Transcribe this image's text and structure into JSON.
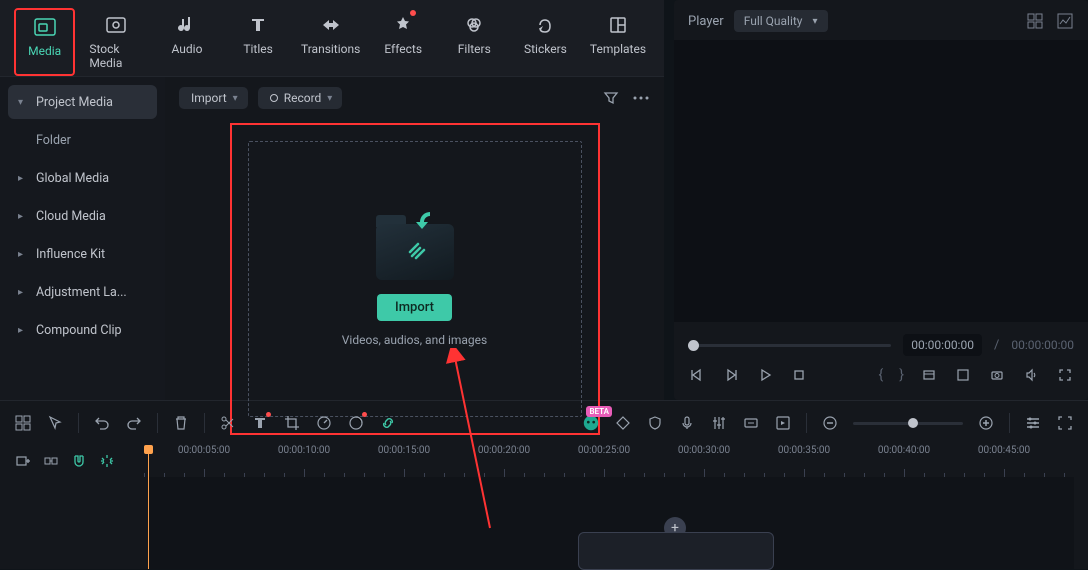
{
  "tabs": [
    {
      "label": "Media"
    },
    {
      "label": "Stock Media"
    },
    {
      "label": "Audio"
    },
    {
      "label": "Titles"
    },
    {
      "label": "Transitions"
    },
    {
      "label": "Effects"
    },
    {
      "label": "Filters"
    },
    {
      "label": "Stickers"
    },
    {
      "label": "Templates"
    }
  ],
  "sidebar": {
    "items": [
      {
        "label": "Project Media"
      },
      {
        "label": "Folder"
      },
      {
        "label": "Global Media"
      },
      {
        "label": "Cloud Media"
      },
      {
        "label": "Influence Kit"
      },
      {
        "label": "Adjustment La..."
      },
      {
        "label": "Compound Clip"
      }
    ]
  },
  "content": {
    "import_btn": "Import",
    "record_btn": "Record",
    "import_pill": "Import",
    "drop_sub": "Videos, audios, and images"
  },
  "player": {
    "title": "Player",
    "quality": "Full Quality",
    "current_time": "00:00:00:00",
    "total_time": "00:00:00:00"
  },
  "timeline": {
    "labels": [
      "00:00:05:00",
      "00:00:10:00",
      "00:00:15:00",
      "00:00:20:00",
      "00:00:25:00",
      "00:00:30:00",
      "00:00:35:00",
      "00:00:40:00",
      "00:00:45:00"
    ],
    "beta": "BETA"
  }
}
